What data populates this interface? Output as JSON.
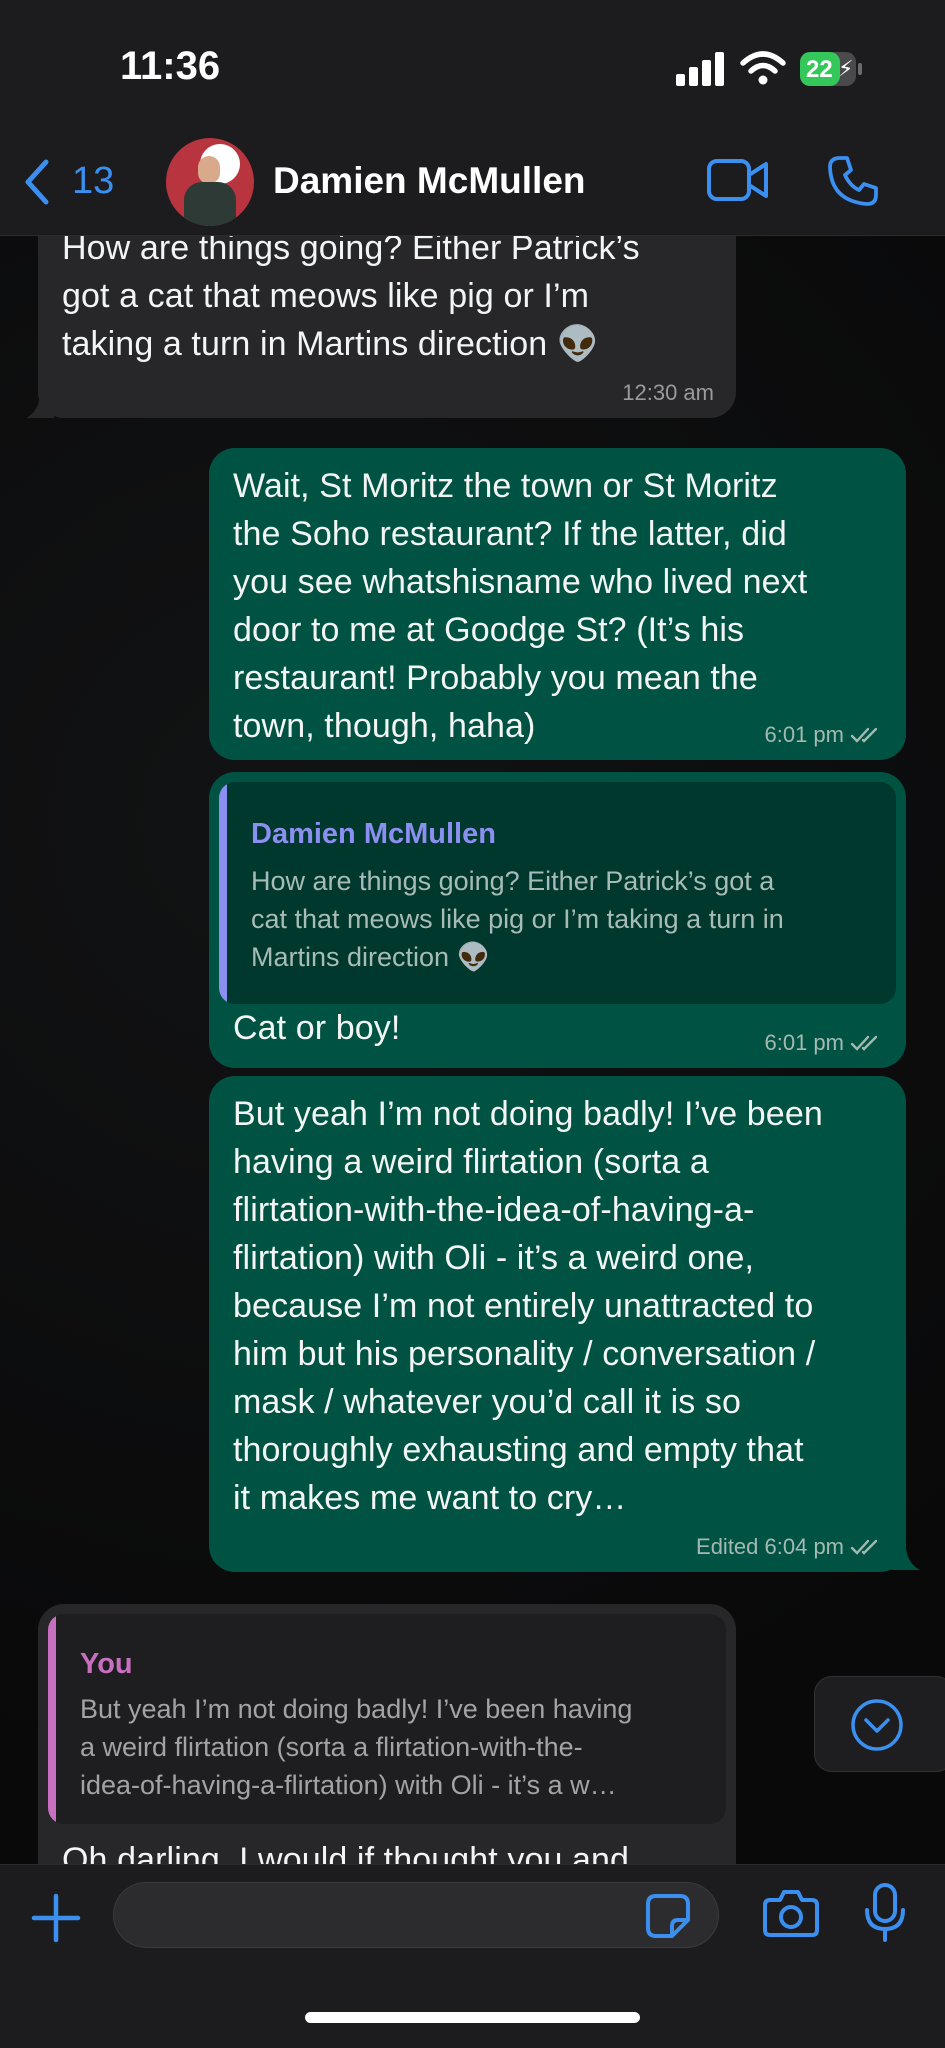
{
  "status_bar": {
    "time": "11:36",
    "battery": "22"
  },
  "header": {
    "back_count": "13",
    "contact_name": "Damien McMullen"
  },
  "messages": [
    {
      "lines": [
        "How are things going? Either Patrick’s",
        "got a cat that meows like pig or I’m",
        "taking a turn in Martins direction 👽"
      ],
      "time": "12:30 am"
    },
    {
      "lines": [
        "Wait, St Moritz the town or St Moritz",
        "the Soho restaurant? If the latter, did",
        "you see whatshisname who lived next",
        "door to me at Goodge St? (It’s his",
        "restaurant! Probably you mean the",
        "town, though, haha)"
      ],
      "time": "6:01 pm"
    },
    {
      "quote_name": "Damien McMullen",
      "quote_lines": [
        "How are things going? Either Patrick’s got a",
        "cat that meows like pig or I’m taking a turn in",
        "Martins direction 👽"
      ],
      "text": "Cat or boy!",
      "time": "6:01 pm"
    },
    {
      "lines": [
        "But yeah I’m not doing badly! I’ve been",
        "having a weird flirtation (sorta a",
        "flirtation-with-the-idea-of-having-a-",
        "flirtation) with Oli - it’s a weird one,",
        "because I’m not entirely unattracted to",
        "him but his personality / conversation /",
        "mask / whatever you’d call it is so",
        "thoroughly exhausting and empty that",
        "it makes me want to cry…"
      ],
      "time": "Edited 6:04 pm"
    },
    {
      "quote_name": "You",
      "quote_lines": [
        "But yeah I’m not doing badly! I’ve been having",
        "a weird flirtation (sorta a flirtation-with-the-",
        "idea-of-having-a-flirtation) with Oli - it’s a w…"
      ],
      "text": "Oh darling, I would if thought you and"
    }
  ],
  "icons": {
    "back": "chevron-left-icon",
    "video": "video-camera-icon",
    "phone": "phone-icon",
    "plus": "plus-icon",
    "sticker": "sticker-icon",
    "camera": "camera-icon",
    "mic": "microphone-icon",
    "scroll_down": "chevron-down-circle-icon"
  },
  "colors": {
    "accent": "#3a8ff0",
    "outgoing_bubble": "#005343",
    "incoming_bubble": "#272729",
    "quote_name_contact": "#8a8ff0",
    "quote_name_you": "#c86fc0"
  }
}
